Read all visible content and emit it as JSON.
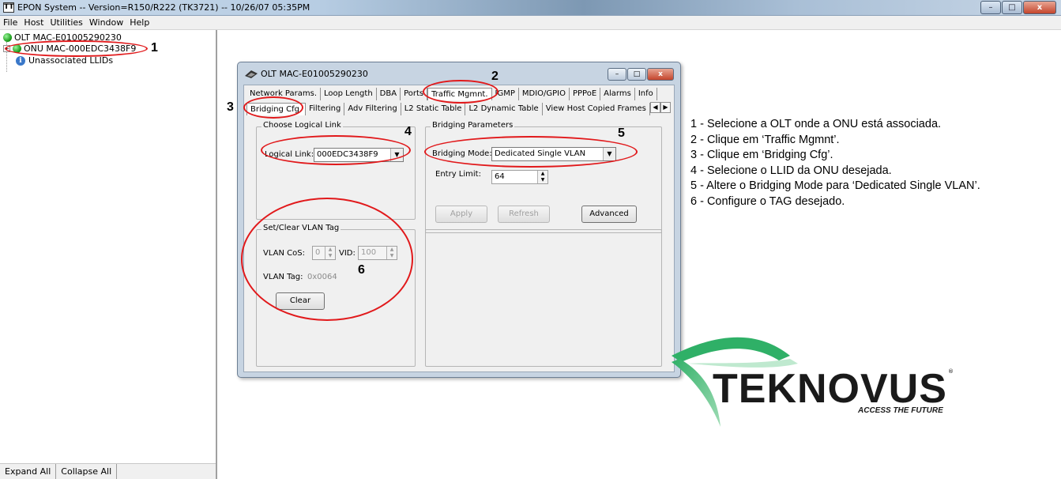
{
  "window": {
    "title": "EPON System -- Version=R150/R222 (TK3721) -- 10/26/07 05:35PM",
    "app_icon_glyph": "TT",
    "controls": {
      "minimize": "–",
      "maximize": "□",
      "close": "x"
    }
  },
  "menu": [
    "File",
    "Host",
    "Utilities",
    "Window",
    "Help"
  ],
  "tree": {
    "items": [
      {
        "label": "OLT MAC-E01005290230",
        "icon": "green-status-icon"
      },
      {
        "label": "ONU MAC-000EDC3438F9",
        "icon": "green-status-icon",
        "expander": "+"
      },
      {
        "label": "Unassociated LLIDs",
        "icon": "info-icon"
      }
    ],
    "buttons": {
      "expand_all": "Expand All",
      "collapse_all": "Collapse All"
    }
  },
  "child_window": {
    "title": "OLT MAC-E01005290230",
    "tabs_row1": [
      "Network Params.",
      "Loop Length",
      "DBA",
      "Ports",
      "Traffic Mgmnt.",
      "IGMP",
      "MDIO/GPIO",
      "PPPoE",
      "Alarms",
      "Info"
    ],
    "tabs_row2": [
      "Bridging Cfg.",
      "Filtering",
      "Adv Filtering",
      "L2 Static Table",
      "L2 Dynamic Table",
      "View Host Copied Frames"
    ],
    "active_tab_row1": "Traffic Mgmnt.",
    "active_tab_row2": "Bridging Cfg.",
    "logical_link_group": {
      "title": "Choose Logical Link",
      "label": "Logical Link:",
      "value": "000EDC3438F9"
    },
    "bridging_group": {
      "title": "Bridging Parameters",
      "mode_label": "Bridging Mode:",
      "mode_value": "Dedicated Single VLAN",
      "entry_limit_label": "Entry Limit:",
      "entry_limit_value": "64",
      "apply": "Apply",
      "refresh": "Refresh",
      "advanced": "Advanced"
    },
    "vlan_group": {
      "title": "Set/Clear VLAN Tag",
      "cos_label": "VLAN CoS:",
      "cos_value": "0",
      "vid_label": "VID:",
      "vid_value": "100",
      "tag_label": "VLAN Tag:",
      "tag_value": "0x0064",
      "clear": "Clear"
    }
  },
  "annotations": {
    "numbers": [
      "1",
      "2",
      "3",
      "4",
      "5",
      "6"
    ],
    "color": "#e1191b"
  },
  "instructions": [
    "1 - Selecione a OLT onde a ONU está associada.",
    "2 - Clique em ‘Traffic Mgmnt’.",
    "3 - Clique em ‘Bridging Cfg’.",
    "4 - Selecione o LLID da ONU desejada.",
    "5 - Altere o Bridging Mode para ‘Dedicated Single VLAN’.",
    "6 - Configure o TAG desejado."
  ],
  "logo": {
    "wordmark": "TEKNOVUS",
    "tagline": "ACCESS THE FUTURE",
    "registered": "®",
    "accent_color": "#2fb067"
  }
}
